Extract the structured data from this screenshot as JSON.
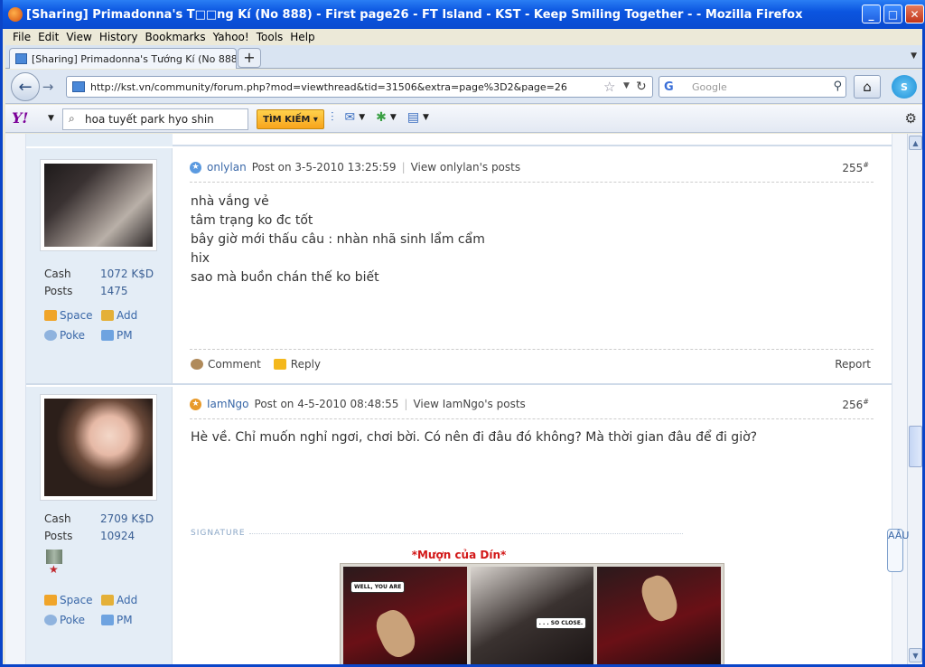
{
  "window": {
    "title": "[Sharing] Primadonna's T□□ng Kí (No 888) - First page26 - FT Island - KST - Keep Smiling Together - - Mozilla Firefox"
  },
  "menu": [
    "File",
    "Edit",
    "View",
    "History",
    "Bookmarks",
    "Yahoo!",
    "Tools",
    "Help"
  ],
  "tab": {
    "label": "[Sharing] Primadonna's Tướng Kí (No 888) - ..."
  },
  "nav": {
    "url": "http://kst.vn/community/forum.php?mod=viewthread&tid=31506&extra=page%3D2&page=26",
    "search_placeholder": "Google"
  },
  "yahoo": {
    "query": "hoa tuyết park hyo shin",
    "button": "TÌM KIẾM"
  },
  "posts": [
    {
      "user": "onlylan",
      "posted": "Post on 3-5-2010 13:25:59",
      "view": "View onlylan's posts",
      "number": "255",
      "sup": "#",
      "cash_label": "Cash",
      "cash": "1072 K$D",
      "posts_label": "Posts",
      "posts": "1475",
      "lines": [
        "nhà vắng vẻ",
        "tâm trạng ko đc tốt",
        "bây giờ mới thấu câu : nhàn nhã sinh lẩm cẩm",
        "hix",
        "sao mà buồn chán thế ko biết"
      ],
      "actions": {
        "comment": "Comment",
        "reply": "Reply",
        "report": "Report"
      }
    },
    {
      "user": "IamNgo",
      "posted": "Post on 4-5-2010 08:48:55",
      "view": "View IamNgo's posts",
      "number": "256",
      "sup": "#",
      "cash_label": "Cash",
      "cash": "2709 K$D",
      "posts_label": "Posts",
      "posts": "10924",
      "lines": [
        "Hè về. Chỉ muốn nghỉ ngơi, chơi bời. Có nên đi đâu đó không? Mà thời gian đâu để đi giờ?"
      ],
      "signature_label": "SIGNATURE",
      "signature_text": "*Mượn của Dín*",
      "comic": [
        "WELL, YOU ARE",
        ". . . SO CLOSE."
      ]
    }
  ],
  "profile_links": {
    "space": "Space",
    "add": "Add",
    "poke": "Poke",
    "pm": "PM"
  },
  "side_widget": "AÂU"
}
